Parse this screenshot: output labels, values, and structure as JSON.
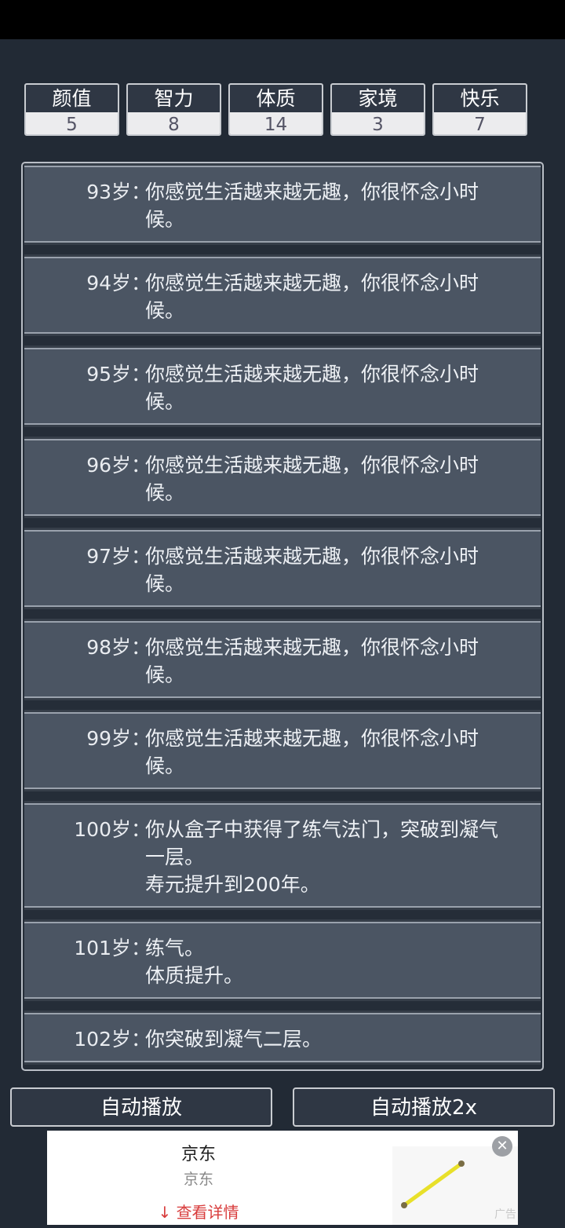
{
  "stats": [
    {
      "label": "颜值",
      "value": "5"
    },
    {
      "label": "智力",
      "value": "8"
    },
    {
      "label": "体质",
      "value": "14"
    },
    {
      "label": "家境",
      "value": "3"
    },
    {
      "label": "快乐",
      "value": "7"
    }
  ],
  "log": [
    {
      "age": "",
      "text": "候。"
    },
    {
      "age": "93岁",
      "text": "你感觉生活越来越无趣，你很怀念小时\n候。"
    },
    {
      "age": "94岁",
      "text": "你感觉生活越来越无趣，你很怀念小时\n候。"
    },
    {
      "age": "95岁",
      "text": "你感觉生活越来越无趣，你很怀念小时\n候。"
    },
    {
      "age": "96岁",
      "text": "你感觉生活越来越无趣，你很怀念小时\n候。"
    },
    {
      "age": "97岁",
      "text": "你感觉生活越来越无趣，你很怀念小时\n候。"
    },
    {
      "age": "98岁",
      "text": "你感觉生活越来越无趣，你很怀念小时\n候。"
    },
    {
      "age": "99岁",
      "text": "你感觉生活越来越无趣，你很怀念小时\n候。"
    },
    {
      "age": "100岁",
      "text": "你从盒子中获得了练气法门，突破到凝气\n一层。\n寿元提升到200年。"
    },
    {
      "age": "101岁",
      "text": "练气。\n体质提升。"
    },
    {
      "age": "102岁",
      "text": "你突破到凝气二层。"
    }
  ],
  "separator": "：",
  "buttons": {
    "autoplay": "自动播放",
    "autoplay2x": "自动播放2x"
  },
  "ad": {
    "title": "京东",
    "subtitle": "京东",
    "cta": "查看详情",
    "tag": "广告",
    "close_icon": "close-icon",
    "cta_icon": "download-arrow-icon"
  }
}
